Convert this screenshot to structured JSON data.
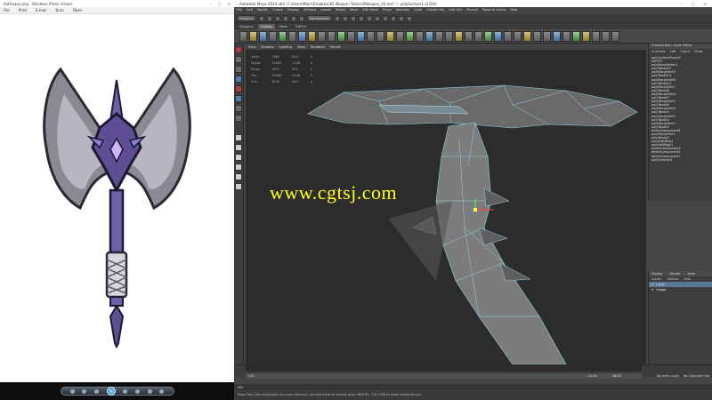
{
  "viewer": {
    "title": "Battleaxe.png - Windows Photo Viewer",
    "menu": [
      "File",
      "Print",
      "E-mail",
      "Burn",
      "Open"
    ]
  },
  "maya": {
    "title": "Autodesk Maya 2014 x64: C:\\Users\\Marc\\Dropbox\\3D Weapon Tutorial\\Weapon_04.ma*  ---  polySurface1.e[336]",
    "menu": [
      "File",
      "Edit",
      "Modify",
      "Create",
      "Display",
      "Window",
      "Assets",
      "Select",
      "Mesh",
      "Edit Mesh",
      "Proxy",
      "Normals",
      "Color",
      "Create UVs",
      "Edit UVs",
      "Muscle",
      "Pipeline Cache",
      "Help"
    ],
    "mode": "Polygons",
    "components_label": "Components",
    "shelf_tabs": [
      "Polygons",
      "Custom",
      "Mesh",
      "TURTLE"
    ],
    "active_shelf_tab": "Custom",
    "panel_menu": [
      "View",
      "Shading",
      "Lighting",
      "Show",
      "Renderer",
      "Panels"
    ],
    "hud": [
      [
        "Verts:",
        "7869",
        "624",
        "0"
      ],
      [
        "Edges:",
        "15640",
        "1248",
        "0"
      ],
      [
        "Faces:",
        "7872",
        "624",
        "0"
      ],
      [
        "Tris:",
        "15380",
        "1248",
        "0"
      ],
      [
        "UVs:",
        "8190",
        "640",
        "0"
      ]
    ],
    "watermark": "www.cgtsj.com",
    "outliner": {
      "title": "Channel Box / Layer Editor",
      "tabs": [
        "Channels",
        "Edit",
        "Object",
        "Show"
      ],
      "items": [
        "polySurfaceShape2",
        "INPUTS",
        "polyMoveVertex1",
        "polyTweak15",
        "polyMergeVert9",
        "polyTweak14",
        "polyMergeVert8",
        "polyTweak13",
        "polyMergeVert7",
        "polyTweak8",
        "polyMergeVert6",
        "polyTweak7",
        "polyMergeVert5",
        "polyTweak6",
        "polyMergeVert4",
        "polyTweak5",
        "polyMergeVert3",
        "polyTweak4",
        "polyMergeVert2",
        "polyTweak3",
        "deleteComponent4",
        "polyMergeVert1",
        "polyTweak2",
        "polySplitRing1",
        "polySoftEdge1",
        "deleteComponent3",
        "deleteComponent2",
        "deleteComponent1",
        "polyCleanUp1"
      ]
    },
    "layers": {
      "tabs": [
        "Display",
        "Render",
        "Anim"
      ],
      "subtabs": [
        "Layers",
        "Options",
        "Help"
      ],
      "rows": [
        {
          "v": "V",
          "name": "Layer",
          "selected": true
        },
        {
          "v": "V",
          "name": "Image",
          "selected": false
        }
      ]
    },
    "timeline": {
      "start": "1.00",
      "end": "24.00",
      "range_end": "48.00",
      "current": "1.00",
      "field": "24",
      "anim_layer": "No Anim Layer",
      "char_set": "No Character Set"
    },
    "cmd_label": "MEL",
    "help": "Move Tool: Use manipulator to move object(s). Use edit mode to change pivot (INSERT). Ctrl+LMB to move perpendicular."
  }
}
